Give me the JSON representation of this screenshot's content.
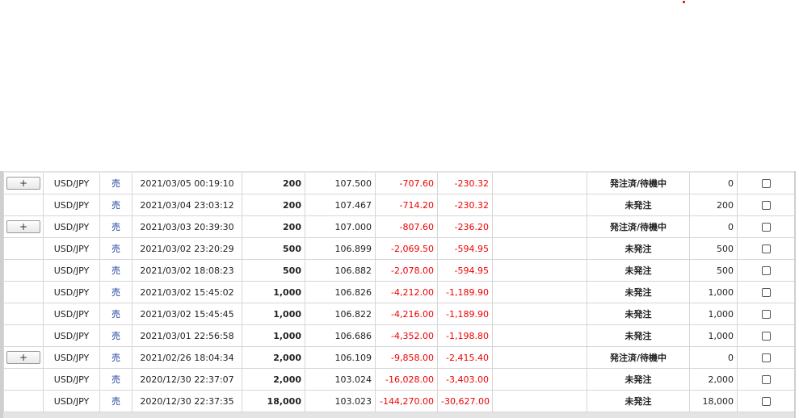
{
  "rows": [
    {
      "expand": "+",
      "pair": "USD/JPY",
      "side": "売",
      "time": "2021/03/05 00:19:10",
      "qty": "200",
      "rate": "107.500",
      "pl": "-707.60",
      "swap": "-230.32",
      "status": "発注済/待機中",
      "remaining": "0"
    },
    {
      "expand": "",
      "pair": "USD/JPY",
      "side": "売",
      "time": "2021/03/04 23:03:12",
      "qty": "200",
      "rate": "107.467",
      "pl": "-714.20",
      "swap": "-230.32",
      "status": "未発注",
      "remaining": "200"
    },
    {
      "expand": "+",
      "pair": "USD/JPY",
      "side": "売",
      "time": "2021/03/03 20:39:30",
      "qty": "200",
      "rate": "107.000",
      "pl": "-807.60",
      "swap": "-236.20",
      "status": "発注済/待機中",
      "remaining": "0"
    },
    {
      "expand": "",
      "pair": "USD/JPY",
      "side": "売",
      "time": "2021/03/02 23:20:29",
      "qty": "500",
      "rate": "106.899",
      "pl": "-2,069.50",
      "swap": "-594.95",
      "status": "未発注",
      "remaining": "500"
    },
    {
      "expand": "",
      "pair": "USD/JPY",
      "side": "売",
      "time": "2021/03/02 18:08:23",
      "qty": "500",
      "rate": "106.882",
      "pl": "-2,078.00",
      "swap": "-594.95",
      "status": "未発注",
      "remaining": "500"
    },
    {
      "expand": "",
      "pair": "USD/JPY",
      "side": "売",
      "time": "2021/03/02 15:45:02",
      "qty": "1,000",
      "rate": "106.826",
      "pl": "-4,212.00",
      "swap": "-1,189.90",
      "status": "未発注",
      "remaining": "1,000"
    },
    {
      "expand": "",
      "pair": "USD/JPY",
      "side": "売",
      "time": "2021/03/02 15:45:45",
      "qty": "1,000",
      "rate": "106.822",
      "pl": "-4,216.00",
      "swap": "-1,189.90",
      "status": "未発注",
      "remaining": "1,000"
    },
    {
      "expand": "",
      "pair": "USD/JPY",
      "side": "売",
      "time": "2021/03/01 22:56:58",
      "qty": "1,000",
      "rate": "106.686",
      "pl": "-4,352.00",
      "swap": "-1,198.80",
      "status": "未発注",
      "remaining": "1,000"
    },
    {
      "expand": "+",
      "pair": "USD/JPY",
      "side": "売",
      "time": "2021/02/26 18:04:34",
      "qty": "2,000",
      "rate": "106.109",
      "pl": "-9,858.00",
      "swap": "-2,415.40",
      "status": "発注済/待機中",
      "remaining": "0"
    },
    {
      "expand": "",
      "pair": "USD/JPY",
      "side": "売",
      "time": "2020/12/30 22:37:07",
      "qty": "2,000",
      "rate": "103.024",
      "pl": "-16,028.00",
      "swap": "-3,403.00",
      "status": "未発注",
      "remaining": "2,000"
    },
    {
      "expand": "",
      "pair": "USD/JPY",
      "side": "売",
      "time": "2020/12/30 22:37:35",
      "qty": "18,000",
      "rate": "103.023",
      "pl": "-144,270.00",
      "swap": "-30,627.00",
      "status": "未発注",
      "remaining": "18,000"
    }
  ],
  "colors": {
    "negative": "#ee0000",
    "side": "#1a3c9c"
  }
}
